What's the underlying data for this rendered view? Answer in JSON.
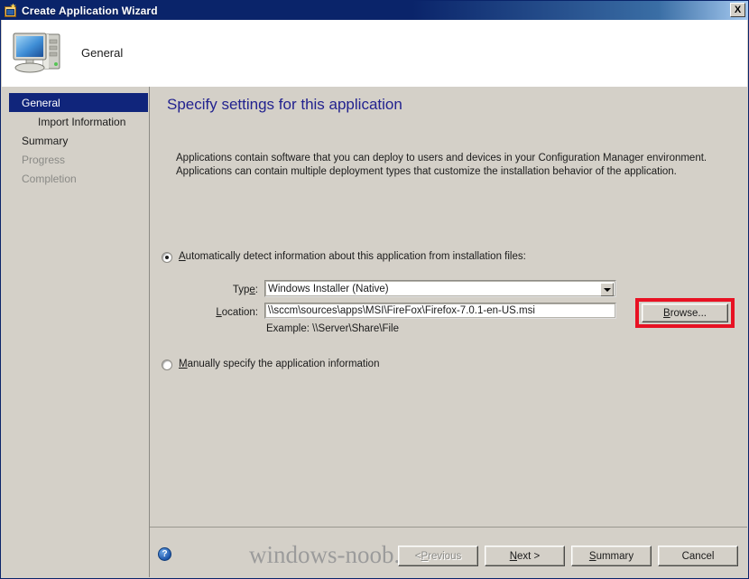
{
  "window": {
    "title": "Create Application Wizard",
    "close_label": "X",
    "title_icon": "wizard-app-icon"
  },
  "header": {
    "label": "General",
    "icon": "computer-monitor-icon"
  },
  "sidebar": {
    "items": [
      {
        "label": "General",
        "state": "selected",
        "indent": false
      },
      {
        "label": "Import Information",
        "state": "normal",
        "indent": true
      },
      {
        "label": "Summary",
        "state": "normal",
        "indent": false
      },
      {
        "label": "Progress",
        "state": "disabled",
        "indent": false
      },
      {
        "label": "Completion",
        "state": "disabled",
        "indent": false
      }
    ]
  },
  "main": {
    "page_title": "Specify settings for this application",
    "description": "Applications contain software that you can deploy to users and devices in your Configuration Manager environment. Applications can contain multiple deployment types that customize the installation behavior of the application.",
    "auto_radio": {
      "label_prefix": "",
      "accel": "A",
      "label_rest": "utomatically detect information about this application from installation files:",
      "checked": true
    },
    "manual_radio": {
      "accel": "M",
      "label_rest": "anually specify the application information",
      "checked": false
    },
    "type_label_pre": "Typ",
    "type_label_accel": "e",
    "type_label_post": ":",
    "type_value": "Windows Installer (Native)",
    "location_label_accel": "L",
    "location_label_rest": "ocation:",
    "location_value": "\\\\sccm\\sources\\apps\\MSI\\FireFox\\Firefox-7.0.1-en-US.msi",
    "example_text": "Example: \\\\Server\\Share\\File",
    "browse_accel": "B",
    "browse_rest": "rowse...",
    "annotation_color": "#e81123"
  },
  "footer": {
    "help_label": "?",
    "watermark": "windows-noob.com",
    "buttons": [
      {
        "pre": "< ",
        "accel": "P",
        "post": "revious",
        "disabled": true,
        "name": "previous-button"
      },
      {
        "pre": "",
        "accel": "N",
        "post": "ext >",
        "disabled": false,
        "name": "next-button"
      },
      {
        "pre": "",
        "accel": "S",
        "post": "ummary",
        "disabled": false,
        "name": "summary-button"
      },
      {
        "pre": "Cancel",
        "accel": "",
        "post": "",
        "disabled": false,
        "name": "cancel-button"
      }
    ]
  }
}
